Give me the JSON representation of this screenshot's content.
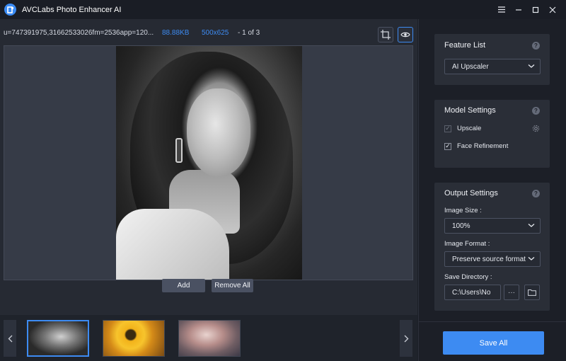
{
  "app": {
    "title": "AVCLabs Photo Enhancer AI",
    "accent_color": "#3d8bf2"
  },
  "window_controls": {
    "menu_icon": "menu-icon",
    "minimize_icon": "minimize-icon",
    "maximize_icon": "maximize-icon",
    "close_icon": "close-icon"
  },
  "file_info": {
    "name": "u=747391975,31662533026fm=2536app=120...",
    "size": "88.88KB",
    "dimensions": "500x625",
    "index": "- 1 of 3"
  },
  "toolbar": {
    "crop_icon": "crop-icon",
    "preview_icon": "eye-icon"
  },
  "actions": {
    "add_label": "Add",
    "remove_all_label": "Remove All"
  },
  "thumbnails": [
    {
      "description_icon": "thumbnail-portrait-bw",
      "selected": true
    },
    {
      "description_icon": "thumbnail-sunflower",
      "selected": false
    },
    {
      "description_icon": "thumbnail-portrait-color",
      "selected": false
    }
  ],
  "right_panel": {
    "feature_list": {
      "title": "Feature List",
      "selected": "AI Upscaler"
    },
    "model_settings": {
      "title": "Model Settings",
      "upscale_label": "Upscale",
      "upscale_checked": true,
      "face_refinement_label": "Face Refinement",
      "face_refinement_checked": true
    },
    "output_settings": {
      "title": "Output Settings",
      "image_size_label": "Image Size :",
      "image_size_value": "100%",
      "image_format_label": "Image Format :",
      "image_format_value": "Preserve source format",
      "save_directory_label": "Save Directory :",
      "save_directory_value": "C:\\Users\\Nо",
      "browse_label": "···"
    },
    "save_all_label": "Save All"
  }
}
